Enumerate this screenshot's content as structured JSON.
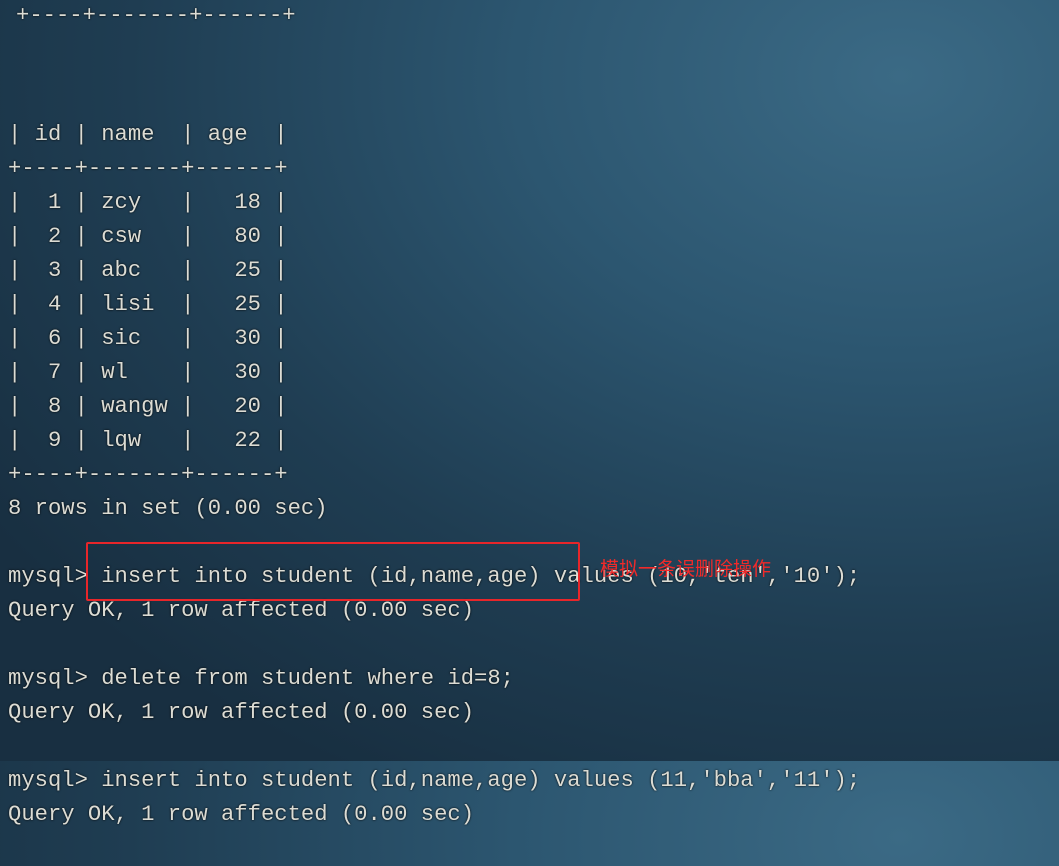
{
  "terminal": {
    "top_border": "+----+-------+------+",
    "lines": [
      "| id | name  | age  |",
      "+----+-------+------+",
      "|  1 | zcy   |   18 |",
      "|  2 | csw   |   80 |",
      "|  3 | abc   |   25 |",
      "|  4 | lisi  |   25 |",
      "|  6 | sic   |   30 |",
      "|  7 | wl    |   30 |",
      "|  8 | wangw |   20 |",
      "|  9 | lqw   |   22 |",
      "+----+-------+------+",
      "8 rows in set (0.00 sec)",
      "",
      "mysql> insert into student (id,name,age) values (10,'ten','10');",
      "Query OK, 1 row affected (0.00 sec)",
      "",
      "mysql> delete from student where id=8;",
      "Query OK, 1 row affected (0.00 sec)",
      "",
      "mysql> insert into student (id,name,age) values (11,'bba','11');",
      "Query OK, 1 row affected (0.00 sec)"
    ]
  },
  "annotation": {
    "text": "模拟一条误删除操作",
    "color": "#f02a2a"
  }
}
